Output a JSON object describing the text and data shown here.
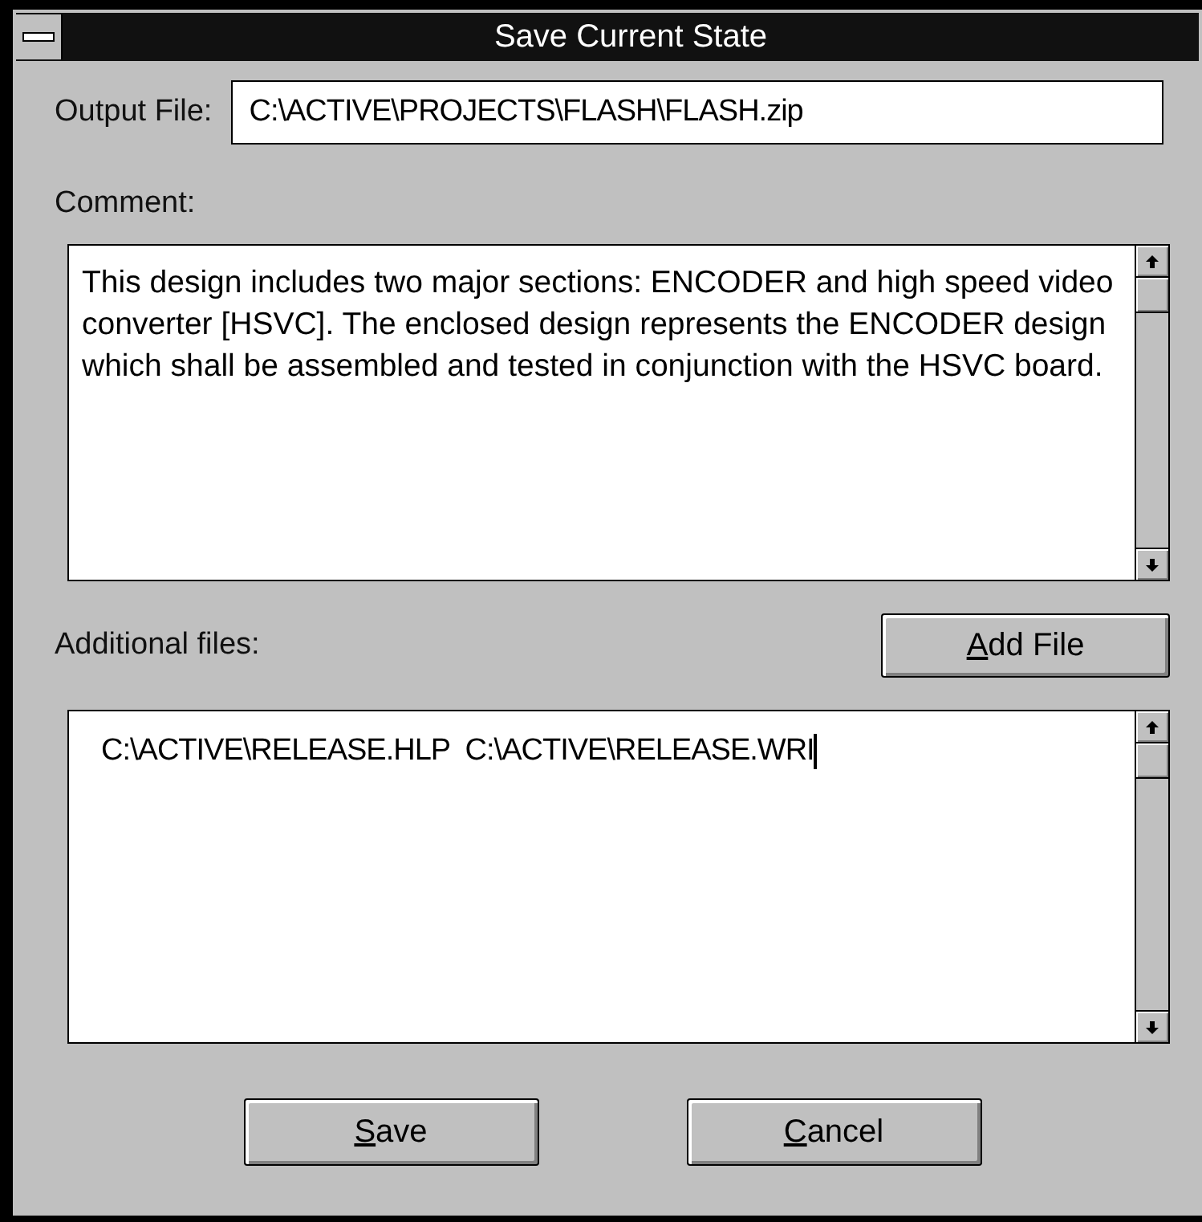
{
  "window": {
    "title": "Save Current State"
  },
  "output_file": {
    "label": "Output File:",
    "value": "C:\\ACTIVE\\PROJECTS\\FLASH\\FLASH.zip"
  },
  "comment": {
    "label": "Comment:",
    "value": "This design includes two major sections: ENCODER and high speed video converter [HSVC]. The enclosed design represents the ENCODER design which shall be assembled and tested in conjunction with the HSVC board."
  },
  "additional_files": {
    "label": "Additional files:",
    "button": "Add File",
    "value": "C:\\ACTIVE\\RELEASE.HLP  C:\\ACTIVE\\RELEASE.WRI"
  },
  "buttons": [
    "Save",
    "Cancel"
  ]
}
